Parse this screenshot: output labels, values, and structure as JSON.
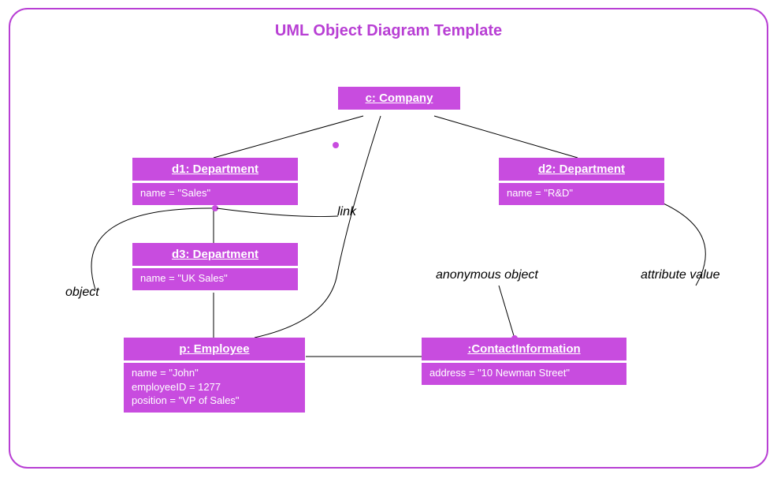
{
  "title": "UML Object Diagram Template",
  "objects": {
    "company": {
      "header": "c: Company"
    },
    "d1": {
      "header": "d1: Department",
      "attr1": "name = \"Sales\""
    },
    "d2": {
      "header": "d2: Department",
      "attr1": "name = \"R&D\""
    },
    "d3": {
      "header": "d3: Department",
      "attr1": "name = \"UK Sales\""
    },
    "p": {
      "header": "p: Employee",
      "attr1": "name = \"John\"",
      "attr2": "employeeID = 1277",
      "attr3": "position = \"VP of Sales\""
    },
    "ci": {
      "header": ":ContactInformation",
      "attr1": "address = \"10 Newman Street\""
    }
  },
  "annotations": {
    "link": "link",
    "object": "object",
    "anonymous": "anonymous object",
    "attrval": "attribute value"
  }
}
